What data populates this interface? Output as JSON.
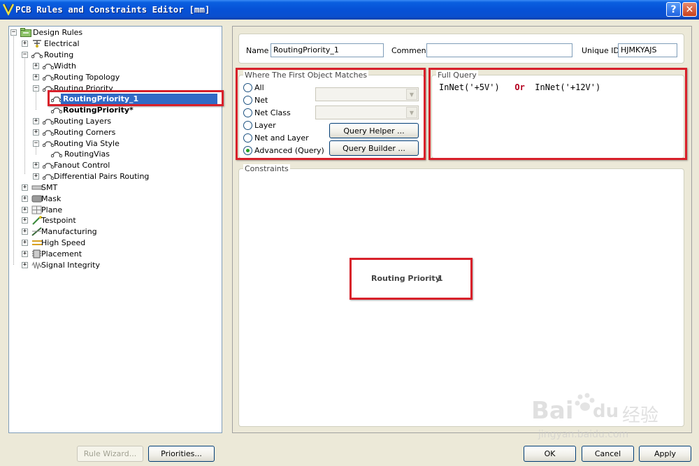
{
  "window": {
    "title": "PCB Rules and Constraints Editor [mm]",
    "help_btn": "?",
    "close_btn": "✕"
  },
  "tree": {
    "root": "Design Rules",
    "electrical": "Electrical",
    "routing": "Routing",
    "width": "Width",
    "routing_topology": "Routing Topology",
    "routing_priority": "Routing Priority",
    "routing_priority_1": "RoutingPriority_1",
    "routing_priority_default": "RoutingPriority*",
    "routing_layers": "Routing Layers",
    "routing_corners": "Routing Corners",
    "routing_via_style": "Routing Via Style",
    "routing_vias": "RoutingVias",
    "fanout_control": "Fanout Control",
    "differential_pairs_routing": "Differential Pairs Routing",
    "smt": "SMT",
    "mask": "Mask",
    "plane": "Plane",
    "testpoint": "Testpoint",
    "manufacturing": "Manufacturing",
    "high_speed": "High Speed",
    "placement": "Placement",
    "signal_integrity": "Signal Integrity"
  },
  "rule": {
    "name_label": "Name",
    "name_value": "RoutingPriority_1",
    "comment_label": "Comment",
    "comment_value": "",
    "uid_label": "Unique ID",
    "uid_value": "HJMKYAJS"
  },
  "matches": {
    "legend": "Where The First Object Matches",
    "opt_all": "All",
    "opt_net": "Net",
    "opt_net_class": "Net Class",
    "opt_layer": "Layer",
    "opt_net_and_layer": "Net and Layer",
    "opt_advanced": "Advanced (Query)",
    "query_helper": "Query Helper ...",
    "query_builder": "Query Builder ..."
  },
  "full_query": {
    "legend": "Full Query",
    "part1": "InNet('+5V')",
    "op": "Or",
    "part2": "InNet('+12V')"
  },
  "constraints": {
    "legend": "Constraints",
    "label": "Routing Priority",
    "value": "1"
  },
  "footer": {
    "rule_wizard": "Rule Wizard...",
    "priorities": "Priorities...",
    "ok": "OK",
    "cancel": "Cancel",
    "apply": "Apply"
  },
  "watermark": {
    "brand_a": "Bai",
    "brand_b": "du",
    "brand_cn": "经验",
    "url": "jingyan.baidu.com"
  },
  "colors": {
    "highlight": "#d8202a",
    "selection": "#316ac5",
    "titlebar": "#0651d6"
  }
}
